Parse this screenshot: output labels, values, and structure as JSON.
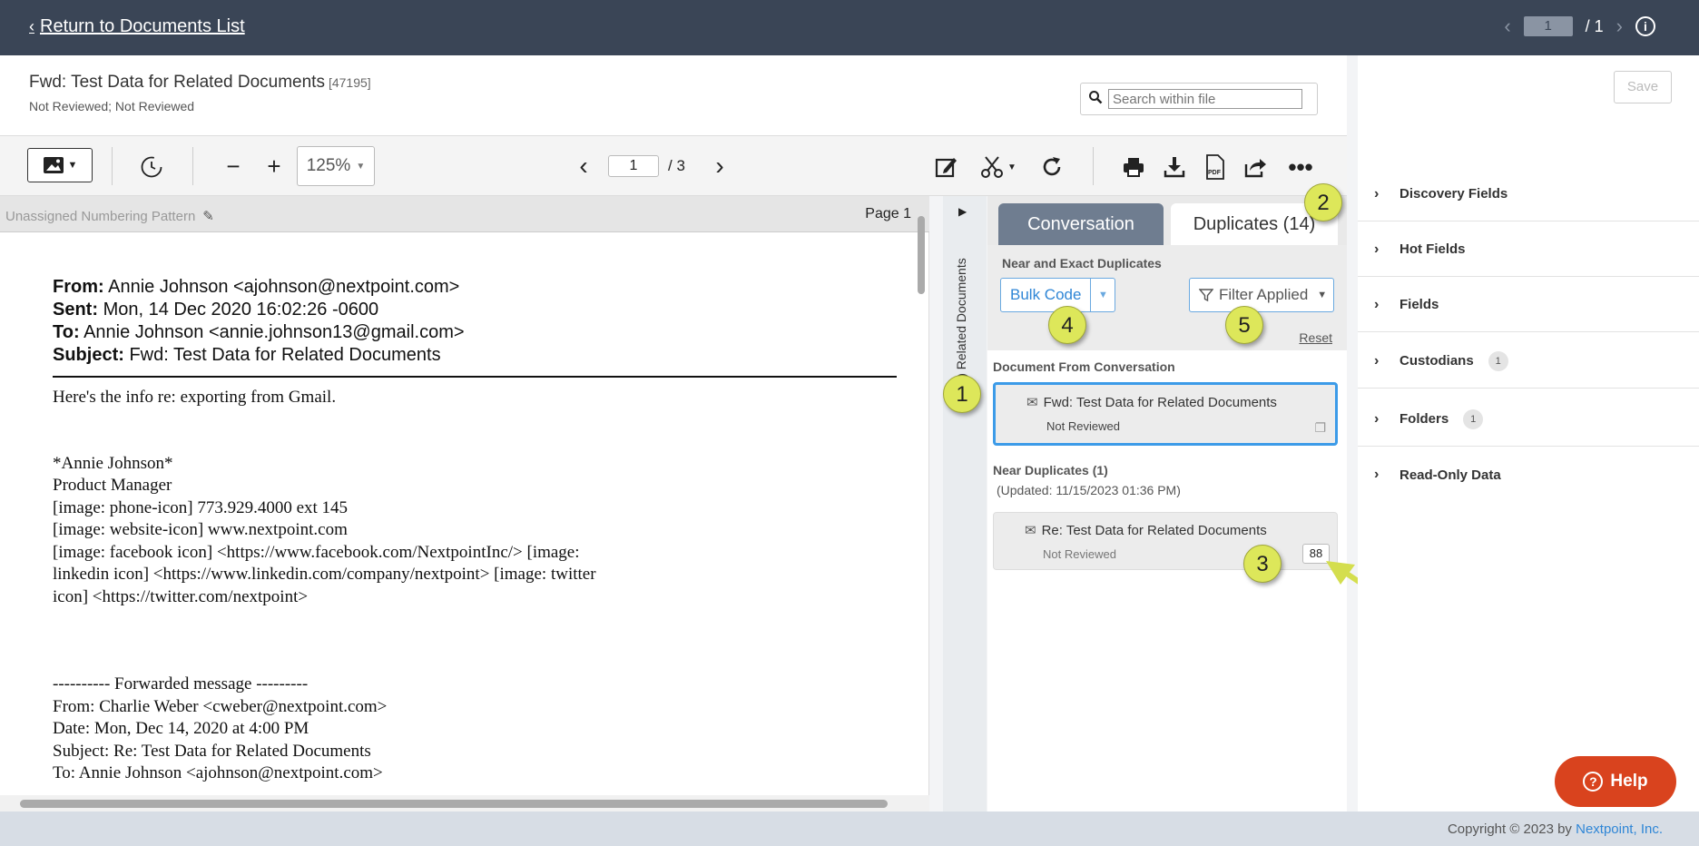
{
  "topbar": {
    "back_label": "Return to Documents List",
    "page_current": "1",
    "page_total": "/ 1"
  },
  "doc": {
    "title": "Fwd: Test Data for Related Documents",
    "id": "[47195]",
    "status": "Not Reviewed; Not Reviewed",
    "search_placeholder": "Search within file"
  },
  "toolbar": {
    "zoom": "125%",
    "page_current": "1",
    "page_total": "/ 3"
  },
  "viewer": {
    "numbering_pattern": "Unassigned Numbering Pattern",
    "page_label": "Page 1",
    "email_header": {
      "from_label": "From:",
      "from_value": "Annie Johnson <ajohnson@nextpoint.com>",
      "sent_label": "Sent:",
      "sent_value": "Mon, 14 Dec 2020 16:02:26 -0600",
      "to_label": "To:",
      "to_value": "Annie Johnson <annie.johnson13@gmail.com>",
      "subject_label": "Subject:",
      "subject_value": "Fwd: Test Data for Related Documents"
    },
    "body_lines": [
      "Here's the info re: exporting from Gmail.",
      "*Annie Johnson*",
      "Product Manager",
      "[image: phone-icon]  773.929.4000 ext 145",
      "[image: website-icon]  www.nextpoint.com",
      "[image: facebook icon] <https://www.facebook.com/NextpointInc/> [image:",
      "linkedin icon] <https://www.linkedin.com/company/nextpoint> [image: twitter",
      "icon] <https://twitter.com/nextpoint>",
      "---------- Forwarded message ---------",
      "From: Charlie Weber <cweber@nextpoint.com>",
      "Date: Mon, Dec 14, 2020 at 4:00 PM",
      "Subject: Re: Test Data for Related Documents",
      "To: Annie Johnson <ajohnson@nextpoint.com>"
    ]
  },
  "related": {
    "strip_label": "(35) Related Documents",
    "tabs": [
      {
        "label": "Conversation"
      },
      {
        "label": "Duplicates (14)"
      }
    ],
    "controls_title": "Near and Exact Duplicates",
    "bulk_code_label": "Bulk Code",
    "filter_label": "Filter Applied",
    "reset_label": "Reset",
    "conversation_section": "Document From Conversation",
    "conversation_doc": {
      "title": "Fwd: Test Data for Related Documents",
      "status": "Not Reviewed"
    },
    "near_section": "Near Duplicates (1)",
    "near_updated": "(Updated: 11/15/2023 01:36 PM)",
    "near_doc": {
      "title": "Re: Test Data for Related Documents",
      "status": "Not Reviewed",
      "score": "88"
    }
  },
  "callouts": [
    "1",
    "2",
    "3",
    "4",
    "5"
  ],
  "metadata": {
    "save_label": "Save",
    "sections": [
      {
        "label": "Discovery Fields",
        "badge": ""
      },
      {
        "label": "Hot Fields",
        "badge": ""
      },
      {
        "label": "Fields",
        "badge": ""
      },
      {
        "label": "Custodians",
        "badge": "1"
      },
      {
        "label": "Folders",
        "badge": "1"
      },
      {
        "label": "Read-Only Data",
        "badge": ""
      }
    ]
  },
  "help_label": "Help",
  "footer": {
    "copyright_prefix": "Copyright © 2023 by",
    "company": "Nextpoint, Inc."
  },
  "colors": {
    "topbar": "#3a4556",
    "accent_blue": "#3c9be8",
    "callout_yellow": "#dde75a",
    "help_red": "#d9431e"
  }
}
